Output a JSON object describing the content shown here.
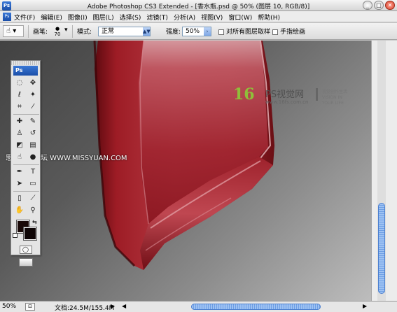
{
  "window": {
    "title": "Adobe Photoshop CS3 Extended - [香水瓶.psd @ 50% (图层 10, RGB/8)]",
    "app_icon": "Ps",
    "buttons": [
      "_",
      "□",
      "✕"
    ]
  },
  "menu": {
    "items": [
      "文件(F)",
      "编辑(E)",
      "图像(I)",
      "图层(L)",
      "选择(S)",
      "滤镜(T)",
      "分析(A)",
      "视图(V)",
      "窗口(W)",
      "帮助(H)"
    ]
  },
  "options": {
    "brush_label": "画笔:",
    "brush_size": "70",
    "mode_label": "模式:",
    "mode_value": "正常",
    "strength_label": "强度:",
    "strength_value": "50%",
    "sample_all_label": "对所有图层取样",
    "finger_paint_label": "手指绘画"
  },
  "watermark": {
    "logo": "16",
    "name": "PS视觉网",
    "url": "www.16fs.com.cn",
    "slogan": "视觉创作生活 VISION IN YOUR LIFE"
  },
  "site_mark": "思缘设计论坛 WWW.MISSYUAN.COM",
  "toolbox": {
    "logo": "Ps",
    "tools": [
      {
        "name": "marquee-tool-icon",
        "glyph": "◌"
      },
      {
        "name": "move-tool-icon",
        "glyph": "✥"
      },
      {
        "name": "lasso-tool-icon",
        "glyph": "ℓ"
      },
      {
        "name": "magic-wand-tool-icon",
        "glyph": "✦"
      },
      {
        "name": "crop-tool-icon",
        "glyph": "⌗"
      },
      {
        "name": "slice-tool-icon",
        "glyph": "⁄"
      },
      {
        "name": "healing-brush-tool-icon",
        "glyph": "✚"
      },
      {
        "name": "brush-tool-icon",
        "glyph": "✎"
      },
      {
        "name": "clone-stamp-tool-icon",
        "glyph": "♙"
      },
      {
        "name": "history-brush-tool-icon",
        "glyph": "↺"
      },
      {
        "name": "eraser-tool-icon",
        "glyph": "◩"
      },
      {
        "name": "gradient-tool-icon",
        "glyph": "▤"
      },
      {
        "name": "smudge-tool-icon",
        "glyph": "☝"
      },
      {
        "name": "dodge-tool-icon",
        "glyph": "●"
      },
      {
        "name": "pen-tool-icon",
        "glyph": "✒"
      },
      {
        "name": "type-tool-icon",
        "glyph": "T"
      },
      {
        "name": "path-selection-tool-icon",
        "glyph": "➤"
      },
      {
        "name": "shape-tool-icon",
        "glyph": "▭"
      },
      {
        "name": "notes-tool-icon",
        "glyph": "▯"
      },
      {
        "name": "eyedropper-tool-icon",
        "glyph": "⟋"
      },
      {
        "name": "hand-tool-icon",
        "glyph": "✋"
      },
      {
        "name": "zoom-tool-icon",
        "glyph": "⚲"
      }
    ],
    "foreground_color": "#1a0a08",
    "background_color": "#0f0606"
  },
  "status": {
    "zoom": "50%",
    "doc_size": "文档:24.5M/155.4M"
  },
  "colors": {
    "bottle_red": "#9a1c24",
    "scroll_blue": "#6e9fe4"
  }
}
